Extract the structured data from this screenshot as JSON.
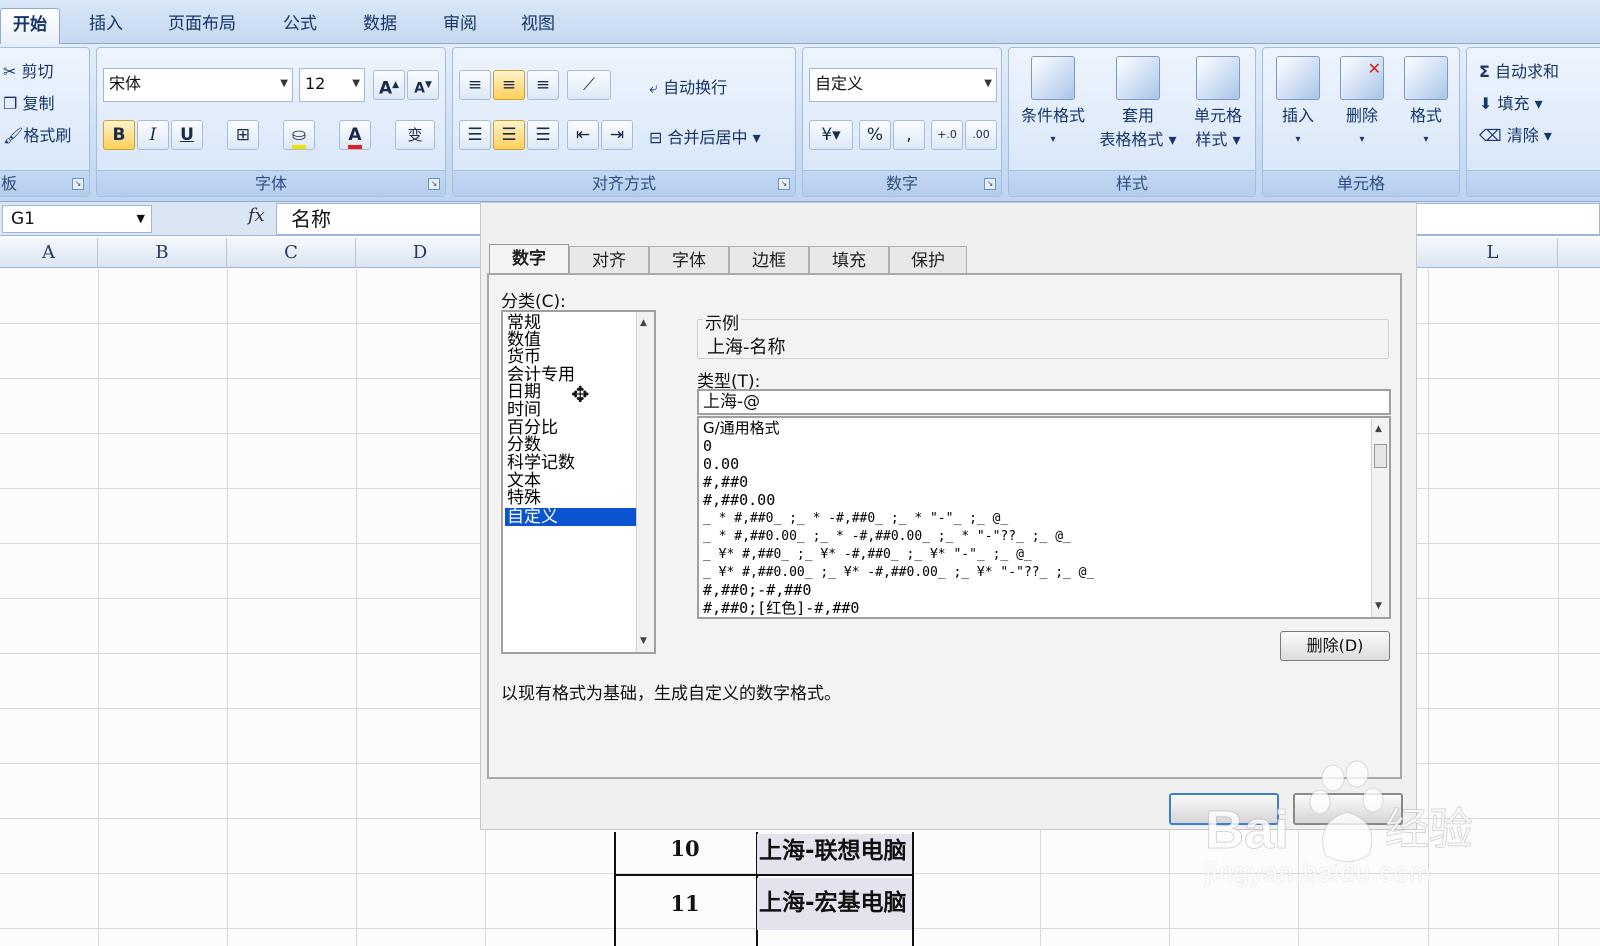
{
  "ribbon_tabs": [
    "开始",
    "插入",
    "页面布局",
    "公式",
    "数据",
    "审阅",
    "视图"
  ],
  "clipboard": {
    "cut": "剪切",
    "copy": "复制",
    "format_painter": "格式刷",
    "label": "板"
  },
  "font": {
    "name": "宋体",
    "size": "12",
    "grow": "A",
    "shrink": "A",
    "bold": "B",
    "italic": "I",
    "underline": "U",
    "font_color": "A",
    "phonetic": "变",
    "label": "字体"
  },
  "alignment": {
    "wrap_text": "自动换行",
    "merge_center": "合并后居中",
    "label": "对齐方式"
  },
  "number": {
    "format": "自定义",
    "percent": "%",
    "comma": ",",
    "inc_decimal": "+.0",
    "dec_decimal": ".00",
    "label": "数字"
  },
  "styles": {
    "conditional_format": "条件格式",
    "table_format_1": "套用",
    "table_format_2": "表格格式",
    "cell_styles_1": "单元格",
    "cell_styles_2": "样式",
    "label": "样式"
  },
  "cells": {
    "insert": "插入",
    "delete": "删除",
    "format": "格式",
    "label": "单元格"
  },
  "editing": {
    "autosum_icon": "Σ",
    "autosum": "自动求和",
    "fill": "填充",
    "clear": "清除"
  },
  "formula_bar": {
    "name_box": "G1",
    "fx": "fx",
    "formula": "名称"
  },
  "columns": [
    "A",
    "B",
    "C",
    "D",
    "L"
  ],
  "visible_rows": [
    {
      "num": "10",
      "text": "上海-联想电脑"
    },
    {
      "num": "11",
      "text": "上海-宏基电脑"
    }
  ],
  "dialog": {
    "tabs": [
      "数字",
      "对齐",
      "字体",
      "边框",
      "填充",
      "保护"
    ],
    "category_label": "分类(C):",
    "categories": [
      "常规",
      "数值",
      "货币",
      "会计专用",
      "日期",
      "时间",
      "百分比",
      "分数",
      "科学记数",
      "文本",
      "特殊",
      "自定义"
    ],
    "selected_category": "自定义",
    "sample_label": "示例",
    "sample_value": "上海-名称",
    "type_label": "类型(T):",
    "type_value": "上海-@",
    "type_list": [
      "G/通用格式",
      "0",
      "0.00",
      "#,##0",
      "#,##0.00",
      "_ * #,##0_ ;_ * -#,##0_ ;_ * \"-\"_ ;_ @_",
      "_ * #,##0.00_ ;_ * -#,##0.00_ ;_ * \"-\"??_ ;_ @_",
      "_ ¥* #,##0_ ;_ ¥* -#,##0_ ;_ ¥* \"-\"_ ;_ @_",
      "_ ¥* #,##0.00_ ;_ ¥* -#,##0.00_ ;_ ¥* \"-\"??_ ;_ @_",
      "#,##0;-#,##0",
      "#,##0;[红色]-#,##0"
    ],
    "delete_button": "删除(D)",
    "description": "以现有格式为基础，生成自定义的数字格式。"
  },
  "watermark": {
    "brand": "Bai 经验",
    "url": "jingyan.baidu.com"
  },
  "colors": {
    "ribbon_bg": "#c9dcf4",
    "selection": "#0a53d1",
    "dialog_bg": "#f0f0f0"
  }
}
